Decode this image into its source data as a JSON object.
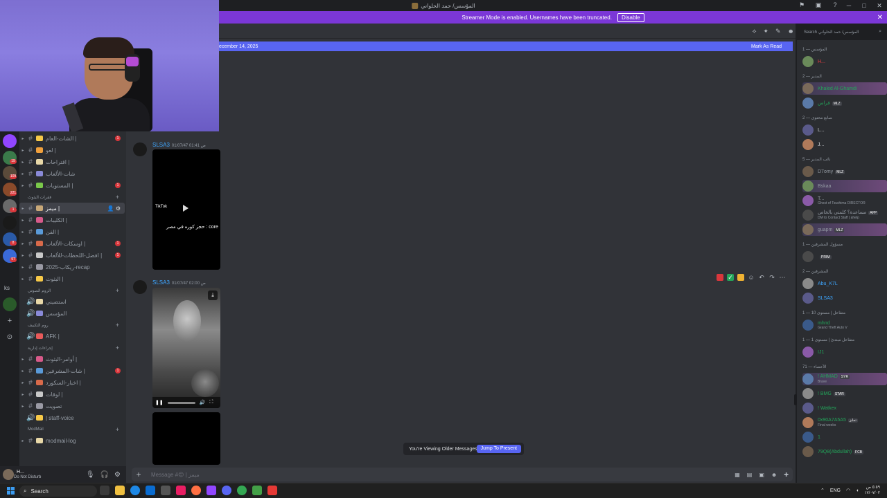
{
  "window": {
    "title": "المؤسس/ حمد الحلواني",
    "icons": [
      "inbox-icon",
      "window-icon",
      "help-icon"
    ],
    "controls": [
      "─",
      "□",
      "✕"
    ]
  },
  "banner": {
    "text": "Streamer Mode is enabled. Usernames have been truncated.",
    "disable_label": "Disable"
  },
  "search": {
    "placeholder": "Search المؤسس/ حمد الحلواني"
  },
  "new_messages": {
    "date_text": "ecember 14, 2025",
    "mark_read": "Mark As Read"
  },
  "rail": {
    "badges": [
      "19",
      "109",
      "221",
      "1",
      "8",
      "97"
    ],
    "ks_label": "ks"
  },
  "channels": [
    {
      "name": "الشات-العام |",
      "badge": "1",
      "kind": "text"
    },
    {
      "name": "لعو |",
      "badge": "",
      "kind": "text"
    },
    {
      "name": "اقتراحات |",
      "badge": "",
      "kind": "text"
    },
    {
      "name": "شات-الألعاب",
      "badge": "",
      "kind": "text"
    },
    {
      "name": "المستويات |",
      "badge": "1",
      "kind": "text"
    },
    {
      "category": "فقرات البثوث"
    },
    {
      "name": "ميمز |",
      "badge": "",
      "kind": "text",
      "active": true
    },
    {
      "name": "الكليبات |",
      "badge": "",
      "kind": "text"
    },
    {
      "name": "الفن |",
      "badge": "",
      "kind": "text"
    },
    {
      "name": "اوسكات-الألعاب |",
      "badge": "1",
      "kind": "text"
    },
    {
      "name": "افضل-اللحظات-للألعاب |",
      "badge": "1",
      "kind": "text"
    },
    {
      "name": "2025-ريكاب-recap",
      "badge": "",
      "kind": "text"
    },
    {
      "name": "البثوث |",
      "badge": "",
      "kind": "text"
    },
    {
      "category": "الروم الصوتي"
    },
    {
      "name": "استضيني",
      "badge": "",
      "kind": "voice"
    },
    {
      "name": "المؤسس",
      "badge": "",
      "kind": "voice"
    },
    {
      "category": "روم التكييف"
    },
    {
      "name": "AFK |",
      "badge": "",
      "kind": "voice"
    },
    {
      "category": "إجراءات إدارية"
    },
    {
      "name": "أوامر-البثوث |",
      "badge": "",
      "kind": "text"
    },
    {
      "name": "شات-المشرفين |",
      "badge": "1",
      "kind": "text"
    },
    {
      "name": "اخبار-السكورد |",
      "badge": "",
      "kind": "text"
    },
    {
      "name": "لوقات |",
      "badge": "",
      "kind": "text"
    },
    {
      "name": "تصويت",
      "badge": "",
      "kind": "text"
    },
    {
      "name": "| staff-voice",
      "badge": "",
      "kind": "voice"
    },
    {
      "category": "ModMail"
    },
    {
      "name": "modmail-log",
      "badge": "",
      "kind": "text"
    }
  ],
  "user": {
    "name": "H...",
    "status": "Do Not Disturb"
  },
  "messages": [
    {
      "author": "SLSA3",
      "time": "01/07/47 01:41 ص",
      "caption": "حجز كوره في مصر : core",
      "logo": "TikTok"
    },
    {
      "author": "SLSA3",
      "time": "01/07/47 02:00 ص"
    }
  ],
  "older_bar": {
    "text": "You're Viewing Older Messages",
    "jump_label": "Jump To Present"
  },
  "composer": {
    "placeholder": "Message #😊 | ميمز"
  },
  "members": {
    "groups": [
      {
        "header": "المؤسس — 1",
        "items": [
          {
            "name": "H...",
            "color": "#f23f43",
            "sub": ""
          }
        ]
      },
      {
        "header": "المدير — 2",
        "items": [
          {
            "name": "Khaled Al-Ghamdi",
            "color": "#23a55a",
            "sub": "",
            "tag": "",
            "hl": true
          },
          {
            "name": "فراس",
            "color": "#23a55a",
            "sub": "",
            "tag": "MLZ"
          }
        ]
      },
      {
        "header": "صانع محتوى — 2",
        "items": [
          {
            "name": "L...",
            "color": "#dbdee1",
            "sub": ""
          },
          {
            "name": "J...",
            "color": "#dbdee1",
            "sub": ""
          }
        ]
      },
      {
        "header": "نائب المدير — 5",
        "items": [
          {
            "name": "D7omy",
            "color": "#949ba4",
            "sub": "",
            "tag": "MLZ"
          },
          {
            "name": "Bskaa",
            "color": "#949ba4",
            "sub": "",
            "hl": true
          },
          {
            "name": "T...",
            "color": "#949ba4",
            "sub": "Ghost of Tsushima DIRECTOR"
          },
          {
            "name": "مساعدة؟ كلمني بالخاص",
            "color": "#949ba4",
            "sub": "DM to Contact Staff | ahelp",
            "tag": "APP"
          },
          {
            "name": "guapm",
            "color": "#949ba4",
            "sub": "",
            "tag": "MLZ",
            "hl": true
          }
        ]
      },
      {
        "header": "مسؤول المشرفين — 1",
        "items": [
          {
            "name": "",
            "color": "#dbdee1",
            "sub": "",
            "tag": "PRIM"
          }
        ]
      },
      {
        "header": "المشرفين — 2",
        "items": [
          {
            "name": "Abu_K7L",
            "color": "#3ea6ff",
            "sub": ""
          },
          {
            "name": "SLSA3",
            "color": "#3ea6ff",
            "sub": ""
          }
        ]
      },
      {
        "header": "متفاعل | مستوى 10 — 1",
        "items": [
          {
            "name": "mhnd",
            "color": "#23a55a",
            "sub": "Grand Theft Auto V"
          }
        ]
      },
      {
        "header": "متفاعل مبتدئ | مستوى 1 — 1",
        "items": [
          {
            "name": "IJ1",
            "color": "#23a55a",
            "sub": ""
          }
        ]
      },
      {
        "header": "الأعضاء — 71",
        "items": [
          {
            "name": "! AHMAD",
            "color": "#23a55a",
            "sub": "Brave",
            "tag": "SYR",
            "hl": true
          },
          {
            "name": "! BMG",
            "color": "#23a55a",
            "sub": "",
            "tag": "STAR"
          },
          {
            "name": "! Watkex",
            "color": "#23a55a",
            "sub": ""
          },
          {
            "name": "0x90A7A5A5",
            "color": "#23a55a",
            "sub": "Final weeks",
            "tag": "تمايز"
          },
          {
            "name": "1",
            "color": "#23a55a",
            "sub": ""
          },
          {
            "name": "79Q8(Abdullah)",
            "color": "#23a55a",
            "sub": "",
            "tag": "FCB"
          }
        ]
      }
    ]
  },
  "taskbar": {
    "search_label": "Search",
    "lang": "ENG",
    "time": "٥:٥٩ ص",
    "date": "١٧/٠٧/٠٢"
  },
  "colors": {
    "accent": "#5865f2",
    "streamer": "#7b37d7",
    "danger": "#da373c"
  }
}
